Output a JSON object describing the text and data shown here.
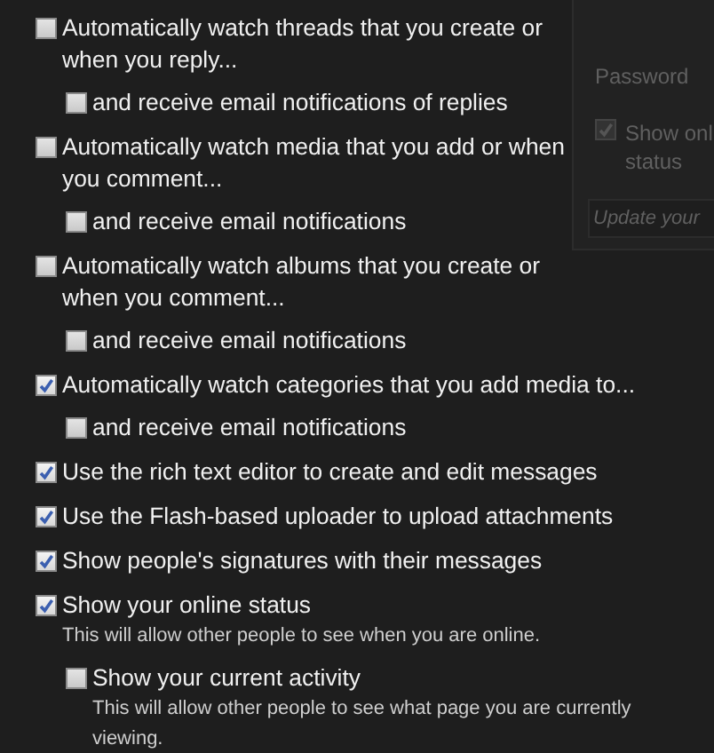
{
  "background_panel": {
    "password_label": "Password",
    "status_checkbox": {
      "label": "Show onl",
      "label_line_2": "status",
      "checked": true
    },
    "field": {
      "placeholder": "Update your"
    }
  },
  "options": [
    {
      "label": "Automatically watch threads that you create or when you reply...",
      "checked": false,
      "children": [
        {
          "label": "and receive email notifications of replies",
          "checked": false
        }
      ]
    },
    {
      "label": "Automatically watch media that you add or when you comment...",
      "checked": false,
      "children": [
        {
          "label": "and receive email notifications",
          "checked": false
        }
      ]
    },
    {
      "label": "Automatically watch albums that you create or when you comment...",
      "checked": false,
      "children": [
        {
          "label": "and receive email notifications",
          "checked": false
        }
      ]
    },
    {
      "label": "Automatically watch categories that you add media to...",
      "checked": true,
      "children": [
        {
          "label": "and receive email notifications",
          "checked": false
        }
      ]
    },
    {
      "label": "Use the rich text editor to create and edit messages",
      "checked": true
    },
    {
      "label": "Use the Flash-based uploader to upload attachments",
      "checked": true
    },
    {
      "label": "Show people's signatures with their messages",
      "checked": true
    },
    {
      "label": "Show your online status",
      "checked": true,
      "hint": "This will allow other people to see when you are online.",
      "children": [
        {
          "label": "Show your current activity",
          "checked": false,
          "hint": "This will allow other people to see what page you are currently viewing."
        }
      ]
    }
  ]
}
